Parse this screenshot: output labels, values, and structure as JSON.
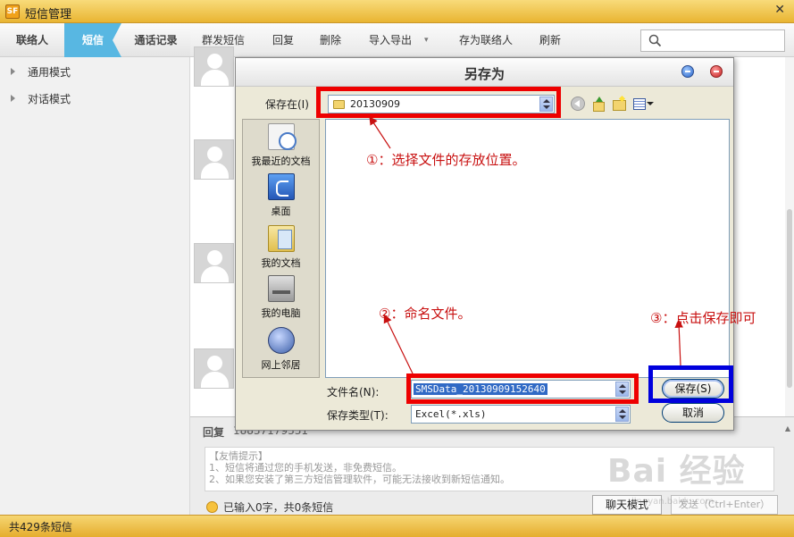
{
  "app": {
    "title": "短信管理",
    "logo_text": "SF",
    "close_glyph": "✕"
  },
  "nav": {
    "tabs": [
      {
        "label": "联络人",
        "active": false
      },
      {
        "label": "短信",
        "active": true
      },
      {
        "label": "通话记录",
        "active": false
      }
    ]
  },
  "toolbar": {
    "bulk_send": "群发短信",
    "reply": "回复",
    "delete": "删除",
    "import_export": "导入导出",
    "dropdown_glyph": "▾",
    "save_contact": "存为联络人",
    "refresh": "刷新",
    "search_placeholder": ""
  },
  "sidebar": {
    "items": [
      {
        "label": "通用模式"
      },
      {
        "label": "对话模式"
      }
    ]
  },
  "reply_panel": {
    "label": "回复",
    "number": "18837179331",
    "tips": [
      "【友情提示】",
      "1、短信将通过您的手机发送，非免费短信。",
      "2、如果您安装了第三方短信管理软件，可能无法接收到新短信通知。"
    ],
    "count_text": "已输入0字，共0条短信",
    "chat_mode_button": "聊天模式",
    "send_button": "发送（Ctrl+Enter）"
  },
  "status": {
    "text": "共429条短信"
  },
  "dialog": {
    "title": "另存为",
    "save_in_label": "保存在(I)",
    "save_in_value": "20130909",
    "places": [
      {
        "label": "我最近的文档",
        "icon": "recent-documents-icon"
      },
      {
        "label": "桌面",
        "icon": "desktop-icon"
      },
      {
        "label": "我的文档",
        "icon": "my-documents-icon"
      },
      {
        "label": "我的电脑",
        "icon": "my-computer-icon"
      },
      {
        "label": "网上邻居",
        "icon": "network-places-icon"
      }
    ],
    "filename_label": "文件名(N):",
    "filename_value": "SMSData_20130909152640",
    "filetype_label": "保存类型(T):",
    "filetype_value": "Excel(*.xls)",
    "save_button": "保存(S)",
    "cancel_button": "取消"
  },
  "annotations": {
    "step1": "①：选择文件的存放位置。",
    "step2": "②：命名文件。",
    "step3": "③：点击保存即可",
    "annotation_color": "#ee0000",
    "highlight_color": "#0000dd"
  },
  "watermark": {
    "text": "Bai 经验",
    "sub": "jingyan.baidu.com"
  },
  "colors": {
    "accent": "#58b7e2",
    "titlebar": "#e9b532",
    "selection": "#316ac5"
  }
}
